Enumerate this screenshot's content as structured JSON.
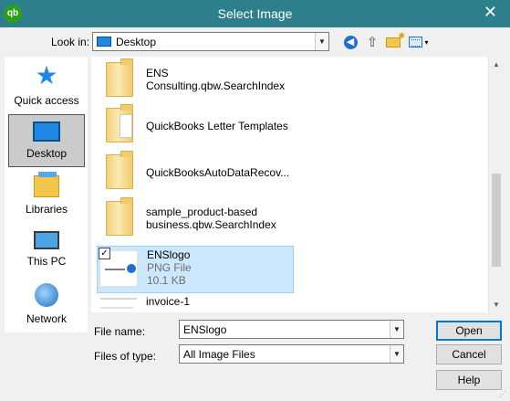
{
  "titlebar": {
    "app_icon_text": "qb",
    "title": "Select Image",
    "close_glyph": "✕"
  },
  "toolbar": {
    "look_in_label": "Look in:",
    "look_in_value": "Desktop",
    "back_glyph": "◀",
    "up_glyph": "⇧",
    "view_caret": "▾",
    "icons": [
      "back-icon",
      "up-folder-icon",
      "new-folder-icon",
      "view-menu-icon"
    ]
  },
  "places": [
    {
      "label": "Quick access",
      "icon": "quick-access-icon"
    },
    {
      "label": "Desktop",
      "icon": "desktop-icon",
      "selected": true
    },
    {
      "label": "Libraries",
      "icon": "libraries-icon"
    },
    {
      "label": "This PC",
      "icon": "this-pc-icon"
    },
    {
      "label": "Network",
      "icon": "network-icon"
    }
  ],
  "files": [
    {
      "line1": "ENS",
      "line2": "Consulting.qbw.SearchIndex",
      "icon": "folder-icon"
    },
    {
      "line1": "QuickBooks Letter Templates",
      "icon": "folder-icon"
    },
    {
      "line1": "QuickBooksAutoDataRecov...",
      "icon": "folder-icon"
    },
    {
      "line1": "sample_product-based",
      "line2": "business.qbw.SearchIndex",
      "icon": "folder-icon"
    },
    {
      "line1": "ENSlogo",
      "type": "PNG File",
      "size": "10.1 KB",
      "selected": true,
      "checked": true,
      "check_glyph": "✓"
    },
    {
      "line1": "invoice-1"
    }
  ],
  "footer": {
    "file_name_label": "File name:",
    "file_name_value": "ENSlogo",
    "files_of_type_label": "Files of type:",
    "files_of_type_value": "All Image Files",
    "dropdown_glyph": "▼"
  },
  "buttons": {
    "open": "Open",
    "cancel": "Cancel",
    "help": "Help"
  },
  "scroll": {
    "up_glyph": "▲",
    "down_glyph": "▼"
  },
  "colors": {
    "titlebar": "#2d7f8c",
    "selection": "#cce8ff",
    "accent": "#0078d7"
  }
}
